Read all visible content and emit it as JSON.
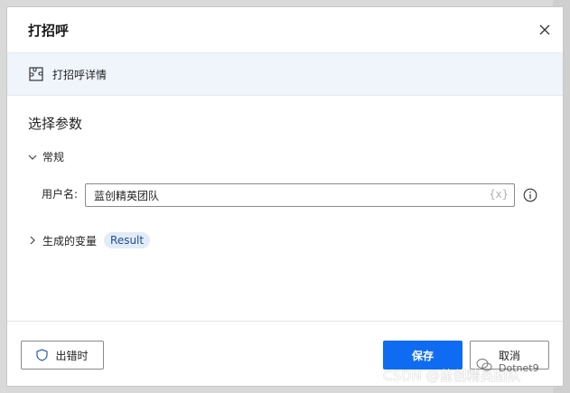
{
  "dialog": {
    "title": "打招呼",
    "details_label": "打招呼详情",
    "section_title": "选择参数",
    "group_label": "常规",
    "field": {
      "label": "用户名:",
      "value": "蓝创精英团队",
      "var_icon": "{x}"
    },
    "generated_vars": {
      "label": "生成的变量",
      "badge": "Result"
    }
  },
  "footer": {
    "on_error_label": "出错时",
    "save_label": "保存",
    "cancel_label": "取消"
  },
  "watermark": {
    "csdn": "CSDN @蓝创精英团队",
    "wechat": "Dotnet9"
  },
  "colors": {
    "primary": "#0f6cf2",
    "band_bg": "#f0f5fc",
    "badge_bg": "#e2ecf8",
    "badge_text": "#1f4f8f"
  },
  "icons": {
    "close": "close-icon",
    "plugin": "plugin-icon",
    "chevron_down": "chevron-down-icon",
    "chevron_right": "chevron-right-icon",
    "info": "info-icon",
    "shield": "shield-icon"
  }
}
